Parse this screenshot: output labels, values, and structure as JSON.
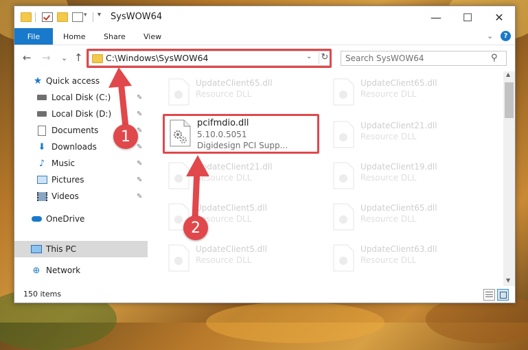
{
  "window": {
    "title": "SysWOW64",
    "minimize_glyph": "—",
    "maximize_glyph": "☐",
    "close_glyph": "✕"
  },
  "ribbon": {
    "tabs": [
      "File",
      "Home",
      "Share",
      "View"
    ],
    "help_glyph": "?",
    "expand_glyph": "⌄"
  },
  "navbar": {
    "back_glyph": "←",
    "forward_glyph": "→",
    "recent_glyph": "⌄",
    "up_glyph": "↑",
    "address": "C:\\Windows\\SysWOW64",
    "address_dropdown_glyph": "⌄",
    "refresh_glyph": "↻",
    "search_placeholder": "Search SysWOW64",
    "search_glyph": "⚲"
  },
  "navpane": {
    "quick_access": "Quick access",
    "items": [
      {
        "label": "Local Disk (C:)",
        "icon": "drive-icon"
      },
      {
        "label": "Local Disk (D:)",
        "icon": "drive-icon"
      },
      {
        "label": "Documents",
        "icon": "documents-icon"
      },
      {
        "label": "Downloads",
        "icon": "downloads-icon"
      },
      {
        "label": "Music",
        "icon": "music-icon"
      },
      {
        "label": "Pictures",
        "icon": "pictures-icon"
      },
      {
        "label": "Videos",
        "icon": "videos-icon"
      }
    ],
    "onedrive": "OneDrive",
    "this_pc": "This PC",
    "network": "Network",
    "pin_glyph": "📌"
  },
  "files": {
    "highlighted": {
      "name": "pcifmdio.dll",
      "version": "5.10.0.5051",
      "description": "Digidesign PCI Supp..."
    },
    "left_column": [
      {
        "name": "UpdateClient65.dll",
        "type": "Resource DLL"
      },
      {
        "name": "UpdateClient21.dll",
        "type": "Resource DLL"
      },
      {
        "name": "UpdateClient5.dll",
        "type": "Resource DLL"
      },
      {
        "name": "UpdateClient5.dll",
        "type": "Resource DLL"
      }
    ],
    "right_column": [
      {
        "name": "UpdateClient65.dll",
        "type": "Resource DLL"
      },
      {
        "name": "UpdateClient21.dll",
        "type": "Resource DLL"
      },
      {
        "name": "UpdateClient19.dll",
        "type": "Resource DLL"
      },
      {
        "name": "UpdateClient65.dll",
        "type": "Resource DLL"
      },
      {
        "name": "UpdateClient63.dll",
        "type": "Resource DLL"
      }
    ]
  },
  "status": {
    "item_count": "150 items"
  },
  "annotations": {
    "step1": "1",
    "step2": "2",
    "color": "#e0484b"
  }
}
